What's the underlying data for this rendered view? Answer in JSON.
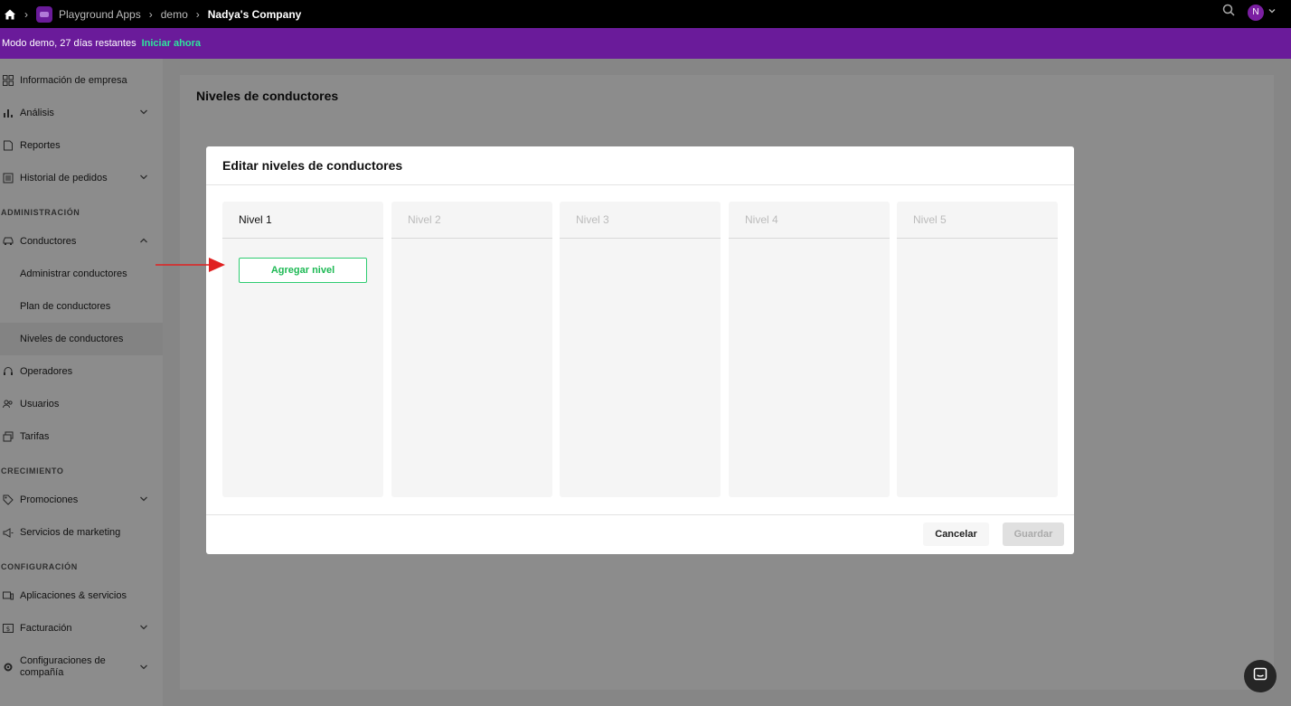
{
  "topbar": {
    "breadcrumb": [
      "Playground Apps",
      "demo",
      "Nadya's Company"
    ],
    "avatar_initial": "N"
  },
  "demo": {
    "text": "Modo demo, 27 días restantes",
    "link": "Iniciar ahora"
  },
  "sidebar": {
    "items": [
      {
        "label": "Información de empresa",
        "icon": "dashboard-icon"
      },
      {
        "label": "Análisis",
        "icon": "bar-chart-icon"
      },
      {
        "label": "Reportes",
        "icon": "document-icon"
      },
      {
        "label": "Historial de pedidos",
        "icon": "list-icon"
      }
    ],
    "admin_label": "ADMINISTRACIÓN",
    "conductores": "Conductores",
    "sub": [
      "Administrar conductores",
      "Plan de conductores",
      "Niveles de conductores"
    ],
    "admin_items": [
      "Operadores",
      "Usuarios",
      "Tarifas"
    ],
    "growth_label": "CRECIMIENTO",
    "growth_items": [
      "Promociones",
      "Servicios de marketing"
    ],
    "config_label": "CONFIGURACIÓN",
    "config_items": [
      "Aplicaciones & servicios",
      "Facturación",
      "Configuraciones de compañía"
    ]
  },
  "page": {
    "title": "Niveles de conductores"
  },
  "modal": {
    "title": "Editar niveles de conductores",
    "levels": [
      "Nivel 1",
      "Nivel 2",
      "Nivel 3",
      "Nivel 4",
      "Nivel 5"
    ],
    "add_label": "Agregar nivel",
    "cancel_label": "Cancelar",
    "save_label": "Guardar"
  },
  "colors": {
    "accent_purple": "#6a1b9a",
    "accent_green": "#2ee59d",
    "annotation_red": "#e02020"
  }
}
